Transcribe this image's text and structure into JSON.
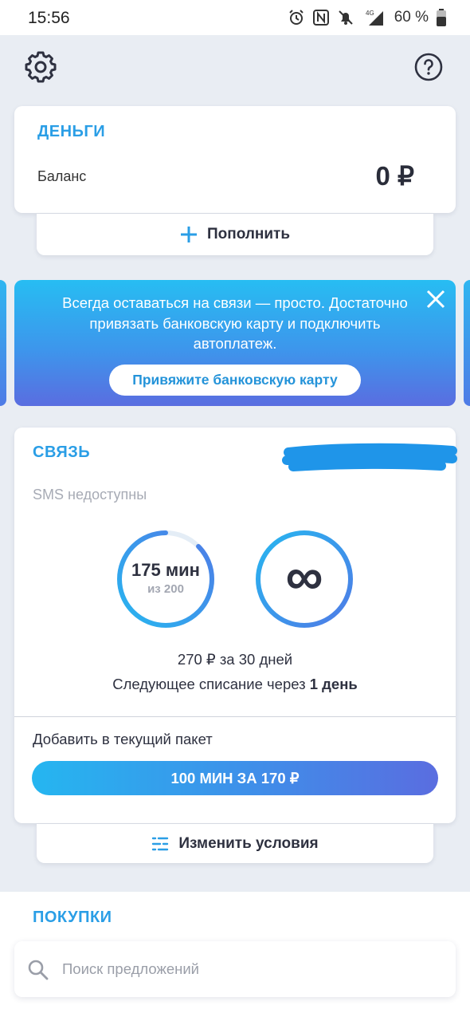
{
  "status_bar": {
    "time": "15:56",
    "battery": "60 %",
    "network": "4G"
  },
  "colors": {
    "accent": "#2a9ee6",
    "background": "#e9edf3",
    "gradient_start": "#27bdf2",
    "gradient_end": "#5a6de0"
  },
  "header": {
    "settings_icon": "gear-icon",
    "help_icon": "help-icon"
  },
  "money": {
    "title": "ДЕНЬГИ",
    "balance_label": "Баланс",
    "balance_value": "0 ₽",
    "topup_label": "Пополнить"
  },
  "promo_banner": {
    "text": "Всегда оставаться на связи — просто. Достаточно привязать банковскую карту и подключить автоплатеж.",
    "button_label": "Привяжите банковскую карту"
  },
  "connection": {
    "title": "СВЯЗЬ",
    "sms_note": "SMS недоступны",
    "minutes_value": "175 мин",
    "minutes_total": "из 200",
    "minutes_remaining_fraction": 0.875,
    "internet_value": "∞",
    "price_line": "270 ₽ за 30 дней",
    "next_charge_prefix": "Следующее списание через",
    "next_charge_value": "1 день",
    "add_label": "Добавить в текущий пакет",
    "package_button": "100 МИН ЗА 170 ₽",
    "change_label": "Изменить условия"
  },
  "purchases": {
    "title": "ПОКУПКИ",
    "search_placeholder": "Поиск предложений"
  }
}
